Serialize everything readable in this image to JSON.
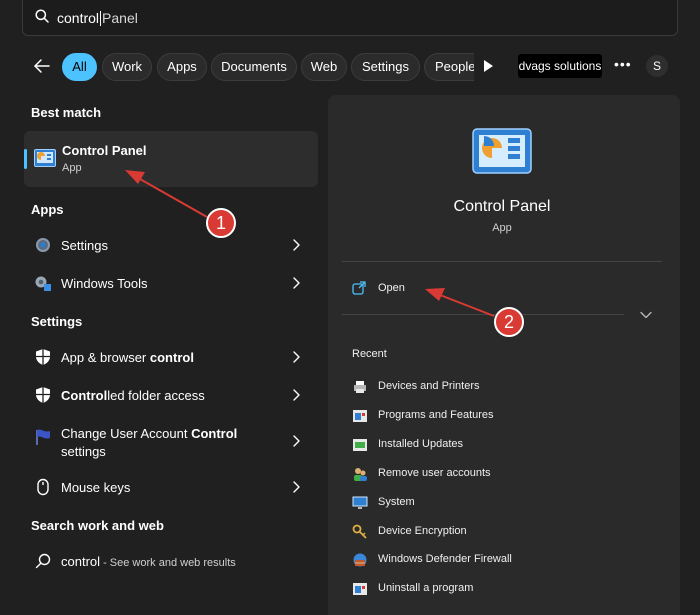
{
  "search": {
    "query_typed": "control",
    "query_suggested": "Panel"
  },
  "filters": {
    "tabs": [
      {
        "label": "All",
        "active": true
      },
      {
        "label": "Work"
      },
      {
        "label": "Apps"
      },
      {
        "label": "Documents"
      },
      {
        "label": "Web"
      },
      {
        "label": "Settings"
      },
      {
        "label": "People"
      }
    ],
    "org_label": "dvags solutions",
    "more_label": "•••",
    "avatar_initial": "S"
  },
  "left": {
    "best_match_heading": "Best match",
    "best_match": {
      "title": "Control Panel",
      "subtitle": "App"
    },
    "apps_heading": "Apps",
    "apps": [
      {
        "label": "Settings"
      },
      {
        "label": "Windows Tools"
      }
    ],
    "settings_heading": "Settings",
    "settings": [
      {
        "pre": "App & browser ",
        "bold": "control",
        "post": ""
      },
      {
        "pre": "",
        "bold": "Control",
        "post": "led folder access"
      },
      {
        "pre": "Change User Account ",
        "bold": "Control",
        "post": "",
        "line2": "settings"
      },
      {
        "pre": "Mouse keys",
        "bold": "",
        "post": ""
      }
    ],
    "web_heading": "Search work and web",
    "web_item": {
      "term": "control",
      "hint": " - See work and web results"
    }
  },
  "panel": {
    "title": "Control Panel",
    "subtitle": "App",
    "open_label": "Open",
    "recent_heading": "Recent",
    "recent": [
      {
        "label": "Devices and Printers"
      },
      {
        "label": "Programs and Features"
      },
      {
        "label": "Installed Updates"
      },
      {
        "label": "Remove user accounts"
      },
      {
        "label": "System"
      },
      {
        "label": "Device Encryption"
      },
      {
        "label": "Windows Defender Firewall"
      },
      {
        "label": "Uninstall a program"
      }
    ]
  },
  "callouts": {
    "one": "1",
    "two": "2"
  },
  "colors": {
    "accent": "#4cc2ff",
    "annotation": "#d93a33",
    "background": "#202020",
    "panel": "#2a2a2a"
  }
}
